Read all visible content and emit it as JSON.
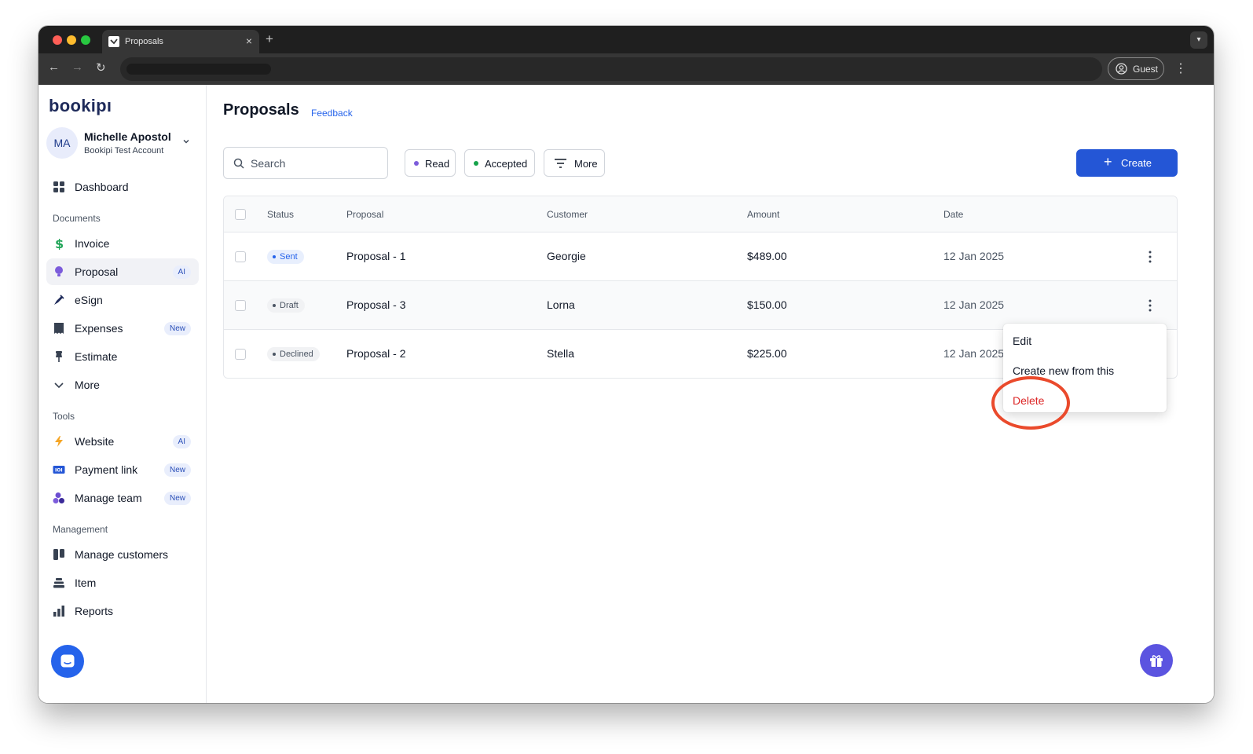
{
  "browser": {
    "tab_title": "Proposals",
    "profile_label": "Guest"
  },
  "sidebar": {
    "logo": "bookipı",
    "account": {
      "initials": "MA",
      "name": "Michelle Apostol",
      "subtitle": "Bookipi Test Account"
    },
    "dashboard": "Dashboard",
    "sections": [
      {
        "label": "Documents",
        "items": [
          {
            "label": "Invoice",
            "icon": "dollar-icon"
          },
          {
            "label": "Proposal",
            "icon": "bulb-icon",
            "badge": "AI",
            "active": true
          },
          {
            "label": "eSign",
            "icon": "pen-icon"
          },
          {
            "label": "Expenses",
            "icon": "receipt-icon",
            "badge": "New"
          },
          {
            "label": "Estimate",
            "icon": "pin-icon"
          },
          {
            "label": "More",
            "icon": "chevron-down-icon"
          }
        ]
      },
      {
        "label": "Tools",
        "items": [
          {
            "label": "Website",
            "icon": "bolt-icon",
            "badge": "AI"
          },
          {
            "label": "Payment link",
            "icon": "payment-link-icon",
            "badge": "New"
          },
          {
            "label": "Manage team",
            "icon": "team-icon",
            "badge": "New"
          }
        ]
      },
      {
        "label": "Management",
        "items": [
          {
            "label": "Manage customers",
            "icon": "customers-icon"
          },
          {
            "label": "Item",
            "icon": "item-stack-icon"
          },
          {
            "label": "Reports",
            "icon": "bar-chart-icon"
          }
        ]
      }
    ]
  },
  "main": {
    "title": "Proposals",
    "feedback": "Feedback",
    "search_placeholder": "Search",
    "filters": [
      {
        "label": "Read",
        "color": "#7c5cdb"
      },
      {
        "label": "Accepted",
        "color": "#16a34a"
      }
    ],
    "more_filter": "More",
    "create_label": "Create",
    "table": {
      "columns": [
        "Status",
        "Proposal",
        "Customer",
        "Amount",
        "Date"
      ],
      "rows": [
        {
          "status": "Sent",
          "status_color": "#2563eb",
          "status_bg": "#e8effd",
          "proposal": "Proposal - 1",
          "customer": "Georgie",
          "amount": "$489.00",
          "date": "12 Jan 2025"
        },
        {
          "status": "Draft",
          "status_color": "#4b5563",
          "status_bg": "#f1f2f4",
          "proposal": "Proposal - 3",
          "customer": "Lorna",
          "amount": "$150.00",
          "date": "12 Jan 2025"
        },
        {
          "status": "Declined",
          "status_color": "#4b5563",
          "status_bg": "#f1f2f4",
          "proposal": "Proposal - 2",
          "customer": "Stella",
          "amount": "$225.00",
          "date": "12 Jan 2025"
        }
      ]
    },
    "context_menu": {
      "items": [
        "Edit",
        "Create new from this",
        "Delete"
      ]
    }
  },
  "colors": {
    "accent": "#2456d6",
    "danger": "#dc2626",
    "annotation": "#ea4a2c"
  }
}
